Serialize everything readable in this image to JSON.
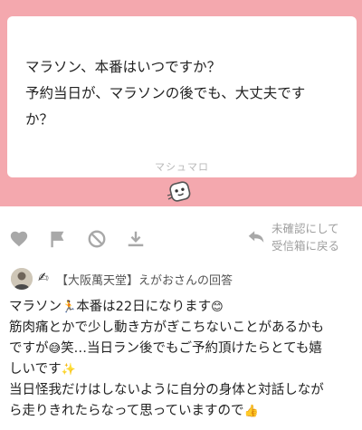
{
  "question": {
    "lines": [
      "マラソン、本番はいつですか？",
      "予約当日が、マラソンの後でも、大丈夫です",
      "か？"
    ],
    "brand": "マシュマロ"
  },
  "actions": {
    "icons": [
      "heart-icon",
      "flag-icon",
      "block-icon",
      "download-icon"
    ],
    "return_icon": "return-arrow-icon",
    "return_line1": "未確認にして",
    "return_line2": "受信箱に戻る"
  },
  "answer": {
    "icon": "pen-icon",
    "answerer": "【大阪萬天堂】えがおさんの回答",
    "l1a": "マラソン",
    "l1_emoji": "🏃",
    "l1b": "本番は22日になります",
    "l1_emoji2": "😊",
    "l2": "筋肉痛とかで少し動き方がぎこちないことがあるかも",
    "l3a": "ですが",
    "l3_emoji": "😅",
    "l3b": "笑…当日ラン後でもご予約頂けたらとても嬉",
    "l4": "しいです",
    "l4_emoji": "✨",
    "l5": "当日怪我だけはしないように自分の身体と対話しなが",
    "l6": "ら走りきれたらなって思っていますので",
    "l6_emoji": "👍"
  },
  "colors": {
    "pink": "#f4a8ae",
    "icon_gray": "#a8a8a8",
    "text": "#222222",
    "muted": "#b8b8b8"
  }
}
